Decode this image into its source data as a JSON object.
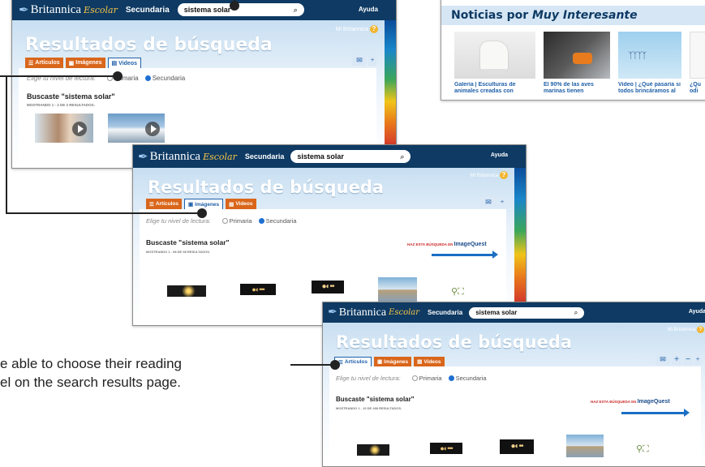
{
  "brand": {
    "name": "Britannica",
    "suffix": "Escolar",
    "level": "Secundaria"
  },
  "search": {
    "query": "sistema solar"
  },
  "header": {
    "help": "Ayuda",
    "my_britannica": "Mi Britannica",
    "my_britannica_icon": "question-mark"
  },
  "results_title": "Resultados de búsqueda",
  "tabs": [
    "Artículos",
    "Imágenes",
    "Videos"
  ],
  "reading_level": {
    "prompt": "Elige tu nivel de lectura:",
    "options": [
      "Primaria",
      "Secundaria"
    ],
    "selected": "Secundaria"
  },
  "searched_for": "Buscaste \"sistema solar\"",
  "screens": {
    "videos": {
      "active_tab": "Videos",
      "showing": "MOSTRANDO 1 - 2 DE 2 RESULTADOS."
    },
    "images": {
      "active_tab": "Imágenes",
      "showing": "MOSTRANDO 1 - 98 DE 98 RESULTADOS."
    },
    "articles": {
      "active_tab": "Artículos",
      "showing": "MOSTRANDO 1 - 10 DE 468 RESULTADOS."
    }
  },
  "imagequest": {
    "label": "HAZ ESTA BÚSQUEDA EN",
    "brand": "ImageQuest"
  },
  "news": {
    "heading": "Noticias por",
    "heading_italic": "Muy Interesante",
    "items": [
      {
        "caption": [
          "Galería | Esculturas de",
          "animales creadas con"
        ]
      },
      {
        "caption": [
          "El 90% de las aves",
          "marinas tienen"
        ]
      },
      {
        "caption": [
          "Video | ¿Qué pasaría si",
          "todos brincáramos al"
        ]
      },
      {
        "caption": [
          "¿Qu",
          "odi"
        ]
      }
    ]
  },
  "callout": {
    "lines": [
      "e able to choose their reading",
      "el on the search results page."
    ]
  }
}
